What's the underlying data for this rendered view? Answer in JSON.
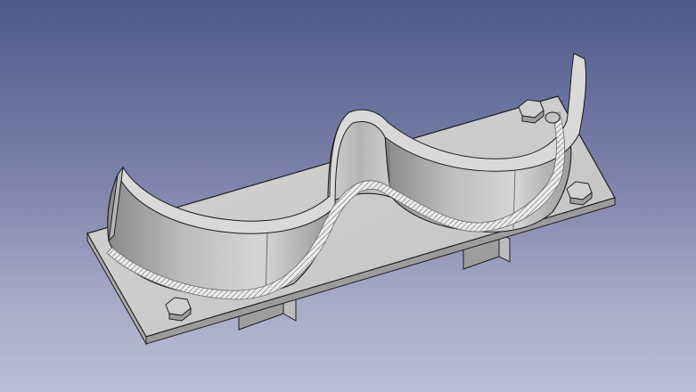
{
  "viewport": {
    "background_top": "#4f5a8c",
    "background_bottom": "#bcbfd6"
  },
  "model": {
    "part_color": "#c7c7c7",
    "edge_color": "#1e1e1e",
    "weld_color": "#e8e8e8",
    "parts": [
      "base-plate",
      "saddle-bracket",
      "weld-bead",
      "hex-bolts",
      "support-blocks"
    ],
    "bolt_count": 4,
    "support_count": 2
  }
}
